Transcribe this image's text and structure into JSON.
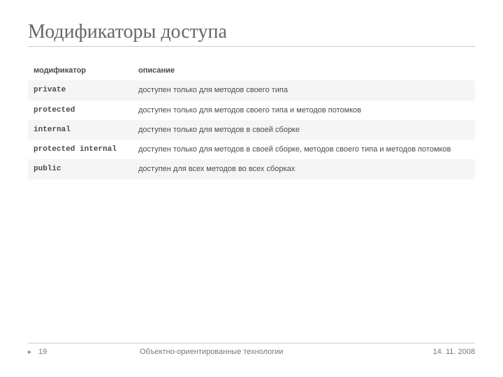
{
  "title": "Модификаторы доступа",
  "table": {
    "header": {
      "modifier": "модификатор",
      "description": "описание"
    },
    "rows": [
      {
        "modifier": "private",
        "description": "доступен только для методов своего типа"
      },
      {
        "modifier": "protected",
        "description": "доступен только для методов своего типа и методов потомков"
      },
      {
        "modifier": "internal",
        "description": "доступен только для методов в своей сборке"
      },
      {
        "modifier": "protected internal",
        "description": "доступен только для методов в своей сборке, методов своего типа и методов потомков"
      },
      {
        "modifier": "public",
        "description": "доступен для всех методов во всех сборках"
      }
    ]
  },
  "footer": {
    "marker": "▸",
    "page": "19",
    "center": "Объектно-ориентированные технологии",
    "date": "14. 11. 2008"
  }
}
